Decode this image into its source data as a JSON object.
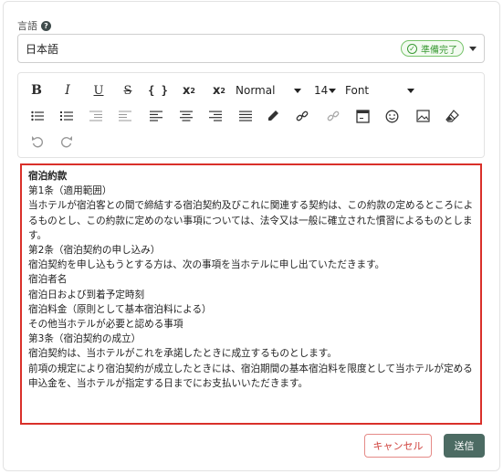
{
  "language_field": {
    "label": "言語",
    "help_icon": "?",
    "selected_value": "日本語",
    "status_badge": "準備完了",
    "status_icon": "check-circle"
  },
  "toolbar": {
    "bold": "B",
    "italic": "I",
    "underline": "U",
    "strikethrough": "S",
    "code": "{ }",
    "superscript": "x",
    "superscript_mark": "2",
    "subscript": "x",
    "subscript_mark": "2",
    "paragraph_style": "Normal",
    "font_size": "14",
    "font_family": "Font"
  },
  "editor": {
    "lines": [
      "宿泊約款",
      "",
      "第1条（適用範囲）",
      "当ホテルが宿泊客との間で締結する宿泊契約及びこれに関連する契約は、この約款の定めるところによるものとし、この約款に定めのない事項については、法令又は一般に確立された慣習によるものとします。",
      "",
      "第2条（宿泊契約の申し込み）",
      "宿泊契約を申し込もうとする方は、次の事項を当ホテルに申し出ていただきます。",
      "宿泊者名",
      "宿泊日および到着予定時刻",
      "宿泊料金（原則として基本宿泊料による）",
      "その他当ホテルが必要と認める事項",
      "",
      "",
      "第3条（宿泊契約の成立）",
      "宿泊契約は、当ホテルがこれを承諾したときに成立するものとします。",
      "前項の規定により宿泊契約が成立したときには、宿泊期間の基本宿泊料を限度として当ホテルが定める申込金を、当ホテルが指定する日までにお支払いいただきます。"
    ]
  },
  "actions": {
    "cancel": "キャンセル",
    "send": "送信"
  },
  "colors": {
    "editor_border": "#d9302a",
    "send_button": "#4c6b63",
    "cancel_text": "#d0433e",
    "badge_green": "#3a9a34"
  }
}
